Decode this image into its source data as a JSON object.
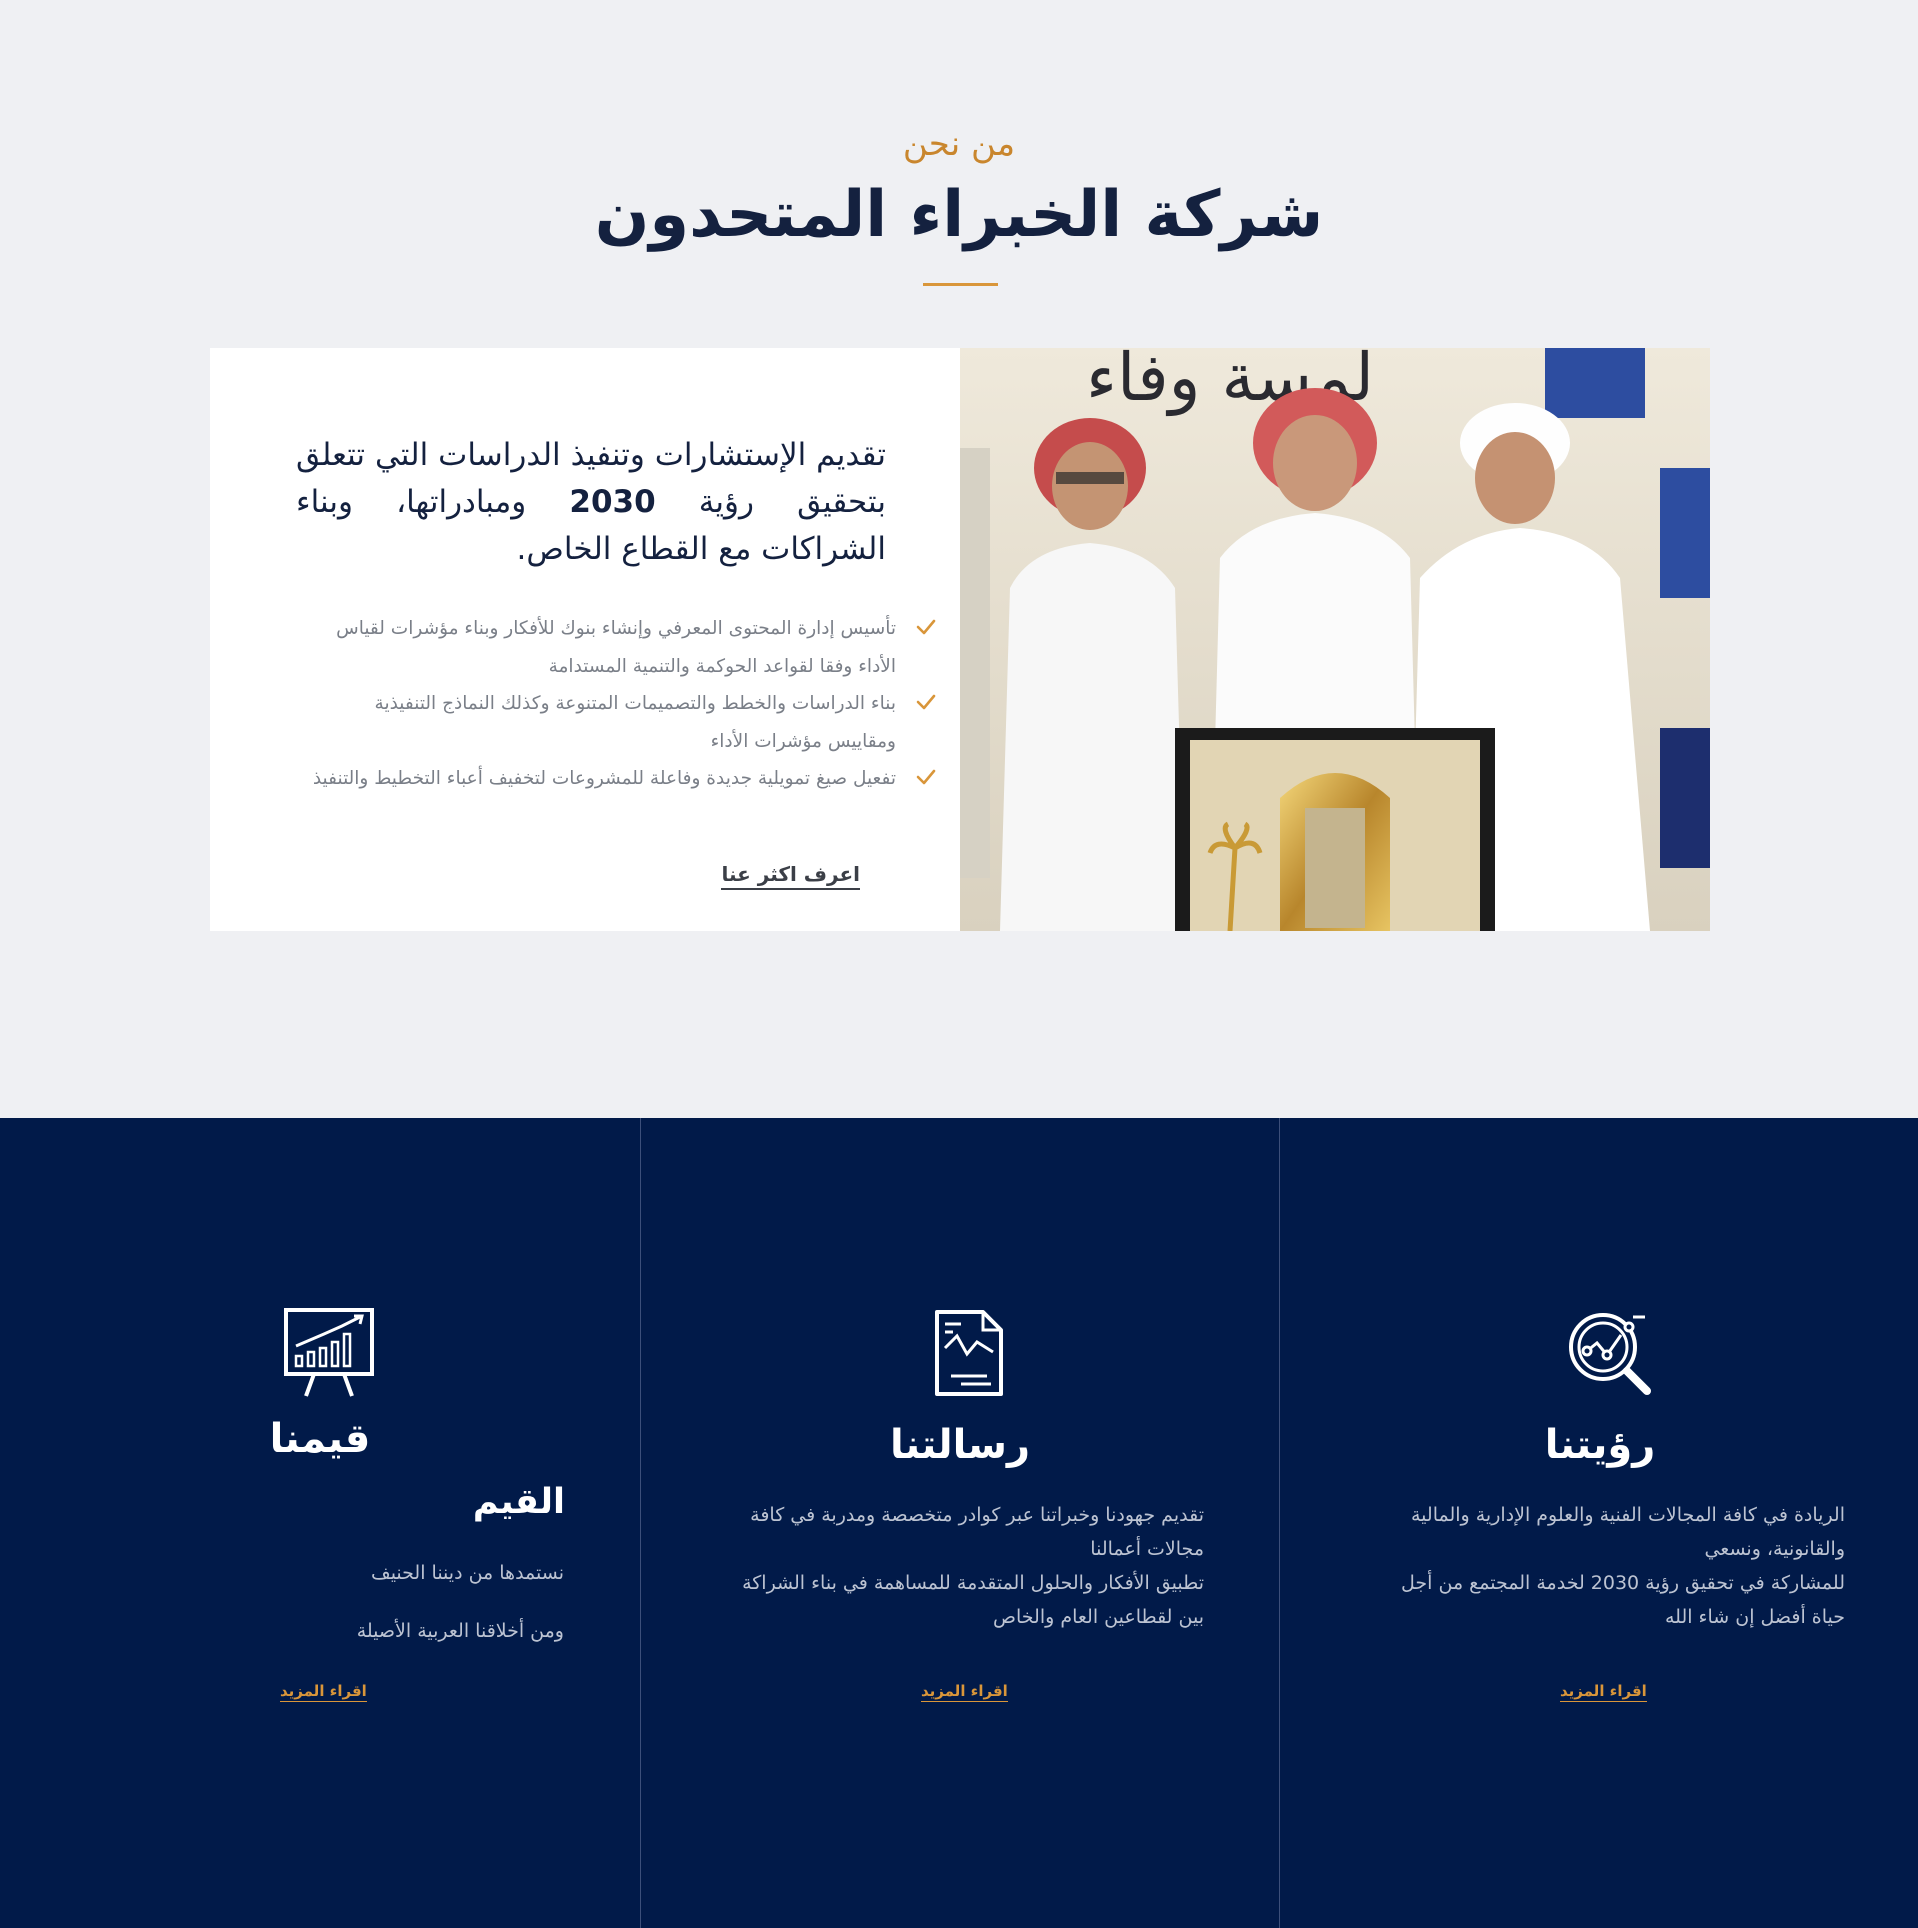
{
  "about": {
    "subtitle": "من نحن",
    "title": "شركة الخبراء المتحدون",
    "lead_part1": "تقديم الإستشارات وتنفيذ الدراسات التي تتعلق بتحقيق رؤية ",
    "lead_year": "2030",
    "lead_part2": " ومبادراتها، وبناء الشراكات مع القطاع الخاص.",
    "bullets": [
      "تأسيس إدارة المحتوى المعرفي وإنشاء بنوك للأفكار وبناء مؤشرات لقياس الأداء وفقا لقواعد الحوكمة والتنمية المستدامة",
      "بناء الدراسات والخطط والتصميمات المتنوعة وكذلك النماذج التنفيذية ومقاييس مؤشرات الأداء",
      "تفعيل صيغ تمويلية جديدة وفاعلة للمشروعات لتخفيف أعباء التخطيط والتنفيذ"
    ],
    "learn_more": "اعرف اكثر عنا",
    "photo_banner": "لمسة وفاء"
  },
  "columns": [
    {
      "icon": "magnifier-chart-icon",
      "title": "رؤيتنا",
      "lines": [
        "الريادة في كافة المجالات الفنية والعلوم الإدارية والمالية والقانونية، ونسعي",
        "للمشاركة في تحقيق رؤية 2030 لخدمة المجتمع من أجل حياة أفضل إن شاء الله"
      ],
      "read_more": "اقراء المزيد"
    },
    {
      "icon": "document-chart-icon",
      "title": "رسالتنا",
      "lines": [
        "تقديم جهودنا وخبراتنا عبر كوادر متخصصة ومدربة في كافة مجالات أعمالنا",
        "تطبيق الأفكار والحلول المتقدمة للمساهمة في بناء الشراكة بين لقطاعين العام والخاص"
      ],
      "read_more": "اقراء المزيد"
    },
    {
      "icon": "presentation-board-icon",
      "title": "قيمنا",
      "subheading": "القيم",
      "lines": [
        "نستمدها من ديننا الحنيف",
        "ومن أخلاقنا العربية الأصيلة"
      ],
      "read_more": "اقراء المزيد"
    }
  ],
  "colors": {
    "navy": "#011a49",
    "gold": "#c9862d",
    "title": "#14213f",
    "background": "#eff0f3"
  }
}
